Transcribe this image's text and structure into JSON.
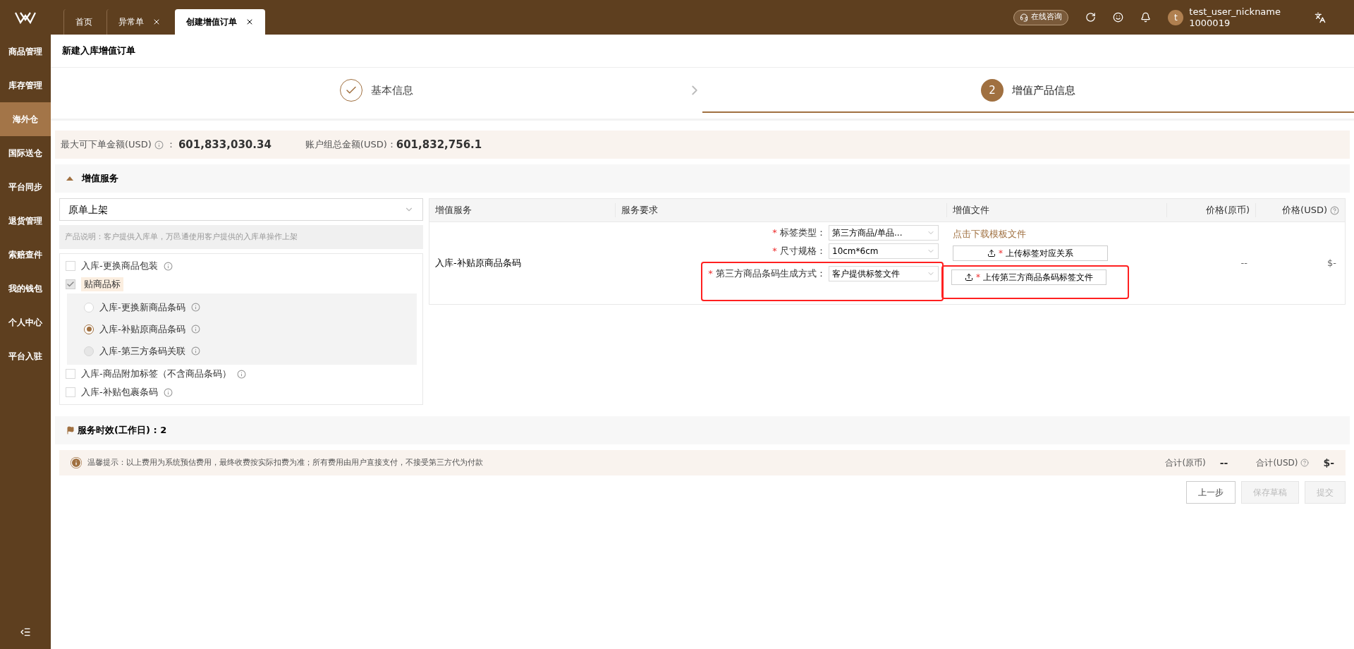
{
  "tabs": [
    {
      "label": "首页",
      "selected": false,
      "closable": false
    },
    {
      "label": "异常单",
      "selected": false,
      "closable": true
    },
    {
      "label": "创建增值订单",
      "selected": true,
      "closable": true
    }
  ],
  "header": {
    "consult": "在线咨询",
    "avatar": "t",
    "username": "test_user_nickname",
    "user_id": "1000019"
  },
  "sidebar": {
    "items": [
      {
        "label": "商品管理",
        "selected": false
      },
      {
        "label": "库存管理",
        "selected": false
      },
      {
        "label": "海外仓",
        "selected": true
      },
      {
        "label": "国际送仓",
        "selected": false
      },
      {
        "label": "平台同步",
        "selected": false
      },
      {
        "label": "退货管理",
        "selected": false
      },
      {
        "label": "索赔查件",
        "selected": false
      },
      {
        "label": "我的钱包",
        "selected": false
      },
      {
        "label": "个人中心",
        "selected": false
      },
      {
        "label": "平台入驻",
        "selected": false
      }
    ]
  },
  "page_title": "新建入库增值订单",
  "steps": [
    {
      "label": "基本信息",
      "done": true,
      "selected": false
    },
    {
      "label": "增值产品信息",
      "number": "2",
      "done": false,
      "selected": true
    }
  ],
  "summary": {
    "max_label": "最大可下单金额(USD)",
    "separator": "：",
    "max_value": "601,833,030.34",
    "total_label": "账户组总金额(USD)：",
    "total_value": "601,832,756.1"
  },
  "section": {
    "title": "增值服务",
    "expanded": true
  },
  "product_select": {
    "value": "原单上架"
  },
  "product_note": "产品说明：客户提供入库单，万邑通使用客户提供的入库单操作上架",
  "options": [
    {
      "kind": "checkbox",
      "label": "入库-更换商品包装",
      "checked": false,
      "disabled": false,
      "info": true
    },
    {
      "kind": "checkbox",
      "label": "贴商品标",
      "checked": true,
      "disabled": true,
      "info": false,
      "children": [
        {
          "kind": "radio",
          "label": "入库-更换新商品条码",
          "selected": false,
          "disabled": false
        },
        {
          "kind": "radio",
          "label": "入库-补贴原商品条码",
          "selected": true,
          "disabled": false
        },
        {
          "kind": "radio",
          "label": "入库-第三方条码关联",
          "selected": false,
          "disabled": true
        }
      ]
    },
    {
      "kind": "checkbox",
      "label": "入库-商品附加标签（不含商品条码）",
      "checked": false,
      "disabled": false,
      "info": true
    },
    {
      "kind": "checkbox",
      "label": "入库-补贴包裹条码",
      "checked": false,
      "disabled": false,
      "info": true
    }
  ],
  "table": {
    "columns": [
      "增值服务",
      "服务要求",
      "增值文件",
      "价格(原币)",
      "价格(USD)"
    ],
    "row": {
      "service": "入库-补贴原商品条码",
      "requirements": [
        {
          "marker": "*",
          "label": "标签类型：",
          "value": "第三方商品/单品...",
          "highlighted": false
        },
        {
          "marker": "*",
          "label": "尺寸规格：",
          "value": "10cm*6cm",
          "highlighted": false
        },
        {
          "marker": "*",
          "label": "第三方商品条码生成方式：",
          "value": "客户提供标签文件",
          "highlighted": true
        }
      ],
      "template_link": "点击下载模板文件",
      "uploads": [
        {
          "marker": "*",
          "label": "上传标签对应关系",
          "highlighted": false
        },
        {
          "marker": "*",
          "label": "上传第三方商品条码标签文件",
          "highlighted": true
        }
      ],
      "price_local": "--",
      "price_usd": "$-"
    }
  },
  "service_time": "服务时效(工作日) : 2",
  "notice": "温馨提示：以上费用为系统预估费用，最终收费按实际扣费为准；所有费用由用户直接支付，不接受第三方代为付款",
  "totals": [
    {
      "label": "合计(原币)",
      "value": "--",
      "help": false
    },
    {
      "label": "合计(USD)",
      "value": "$-",
      "help": true
    }
  ],
  "buttons": [
    {
      "label": "上一步",
      "disabled": false
    },
    {
      "label": "保存草稿",
      "disabled": true
    },
    {
      "label": "提交",
      "disabled": true
    }
  ]
}
